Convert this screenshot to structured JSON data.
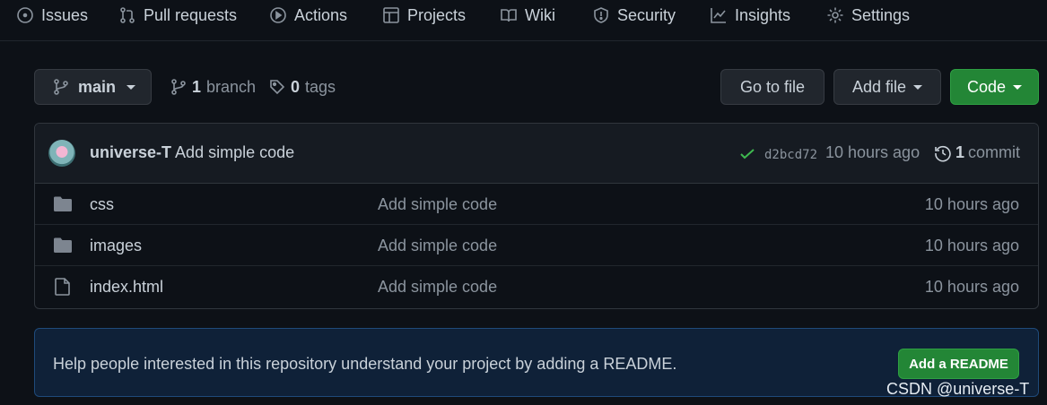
{
  "nav": {
    "tabs": [
      {
        "label": "Issues",
        "icon": "issues-icon"
      },
      {
        "label": "Pull requests",
        "icon": "pull-request-icon"
      },
      {
        "label": "Actions",
        "icon": "actions-icon"
      },
      {
        "label": "Projects",
        "icon": "projects-icon"
      },
      {
        "label": "Wiki",
        "icon": "wiki-icon"
      },
      {
        "label": "Security",
        "icon": "shield-icon"
      },
      {
        "label": "Insights",
        "icon": "graph-icon"
      },
      {
        "label": "Settings",
        "icon": "gear-icon"
      }
    ]
  },
  "repo_bar": {
    "branch": "main",
    "branch_count": "1",
    "branch_label": "branch",
    "tag_count": "0",
    "tag_label": "tags",
    "go_to_file": "Go to file",
    "add_file": "Add file",
    "code": "Code"
  },
  "latest_commit": {
    "author": "universe-T",
    "message": "Add simple code",
    "sha": "d2bcd72",
    "time": "10 hours ago",
    "commit_count": "1",
    "commit_label": "commit"
  },
  "files": [
    {
      "type": "folder",
      "name": "css",
      "message": "Add simple code",
      "time": "10 hours ago"
    },
    {
      "type": "folder",
      "name": "images",
      "message": "Add simple code",
      "time": "10 hours ago"
    },
    {
      "type": "file",
      "name": "index.html",
      "message": "Add simple code",
      "time": "10 hours ago"
    }
  ],
  "readme_prompt": {
    "text": "Help people interested in this repository understand your project by adding a README.",
    "button": "Add a README"
  },
  "watermark": "CSDN @universe-T",
  "colors": {
    "background": "#0d1117",
    "green": "#238636",
    "readme_bg": "#0f2138",
    "check": "#3fb950"
  }
}
